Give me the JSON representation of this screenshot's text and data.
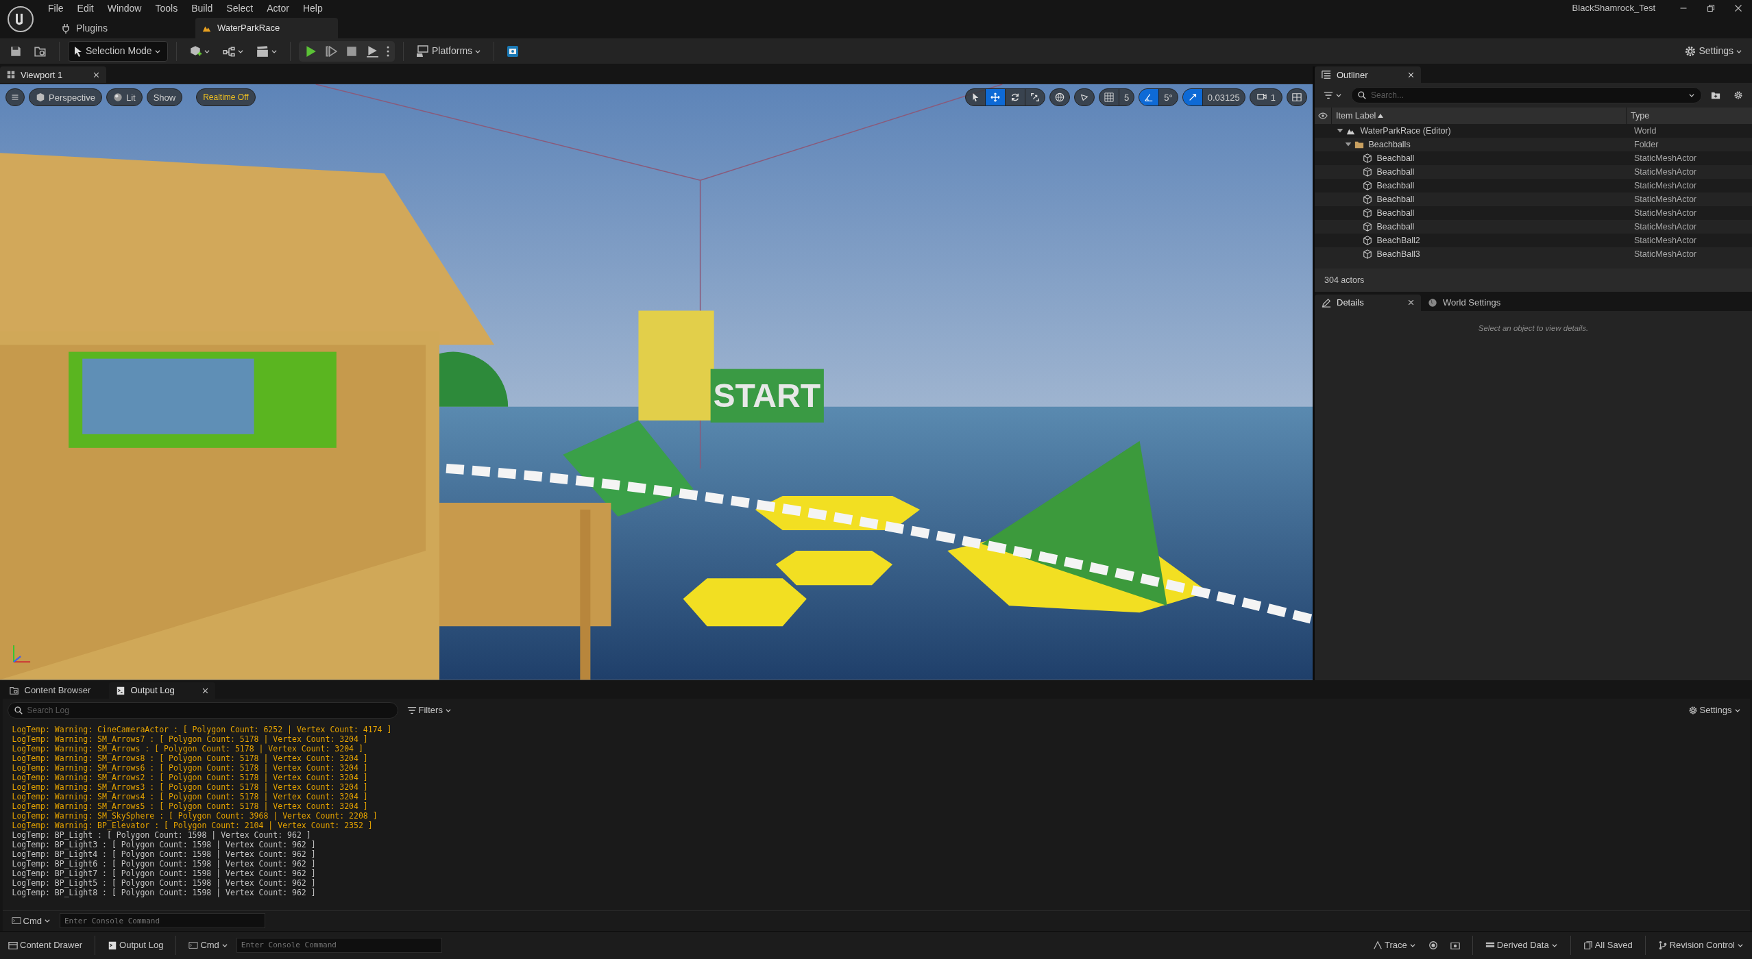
{
  "menu": [
    "File",
    "Edit",
    "Window",
    "Tools",
    "Build",
    "Select",
    "Actor",
    "Help"
  ],
  "project_name": "BlackShamrock_Test",
  "plugins_label": "Plugins",
  "level_tab": {
    "label": "WaterParkRace",
    "selected": true
  },
  "toolbar": {
    "mode_dropdown": "Selection Mode",
    "platforms": "Platforms",
    "settings": "Settings"
  },
  "viewport_tab": {
    "label": "Viewport 1",
    "selected": true
  },
  "viewport": {
    "view_buttons": [
      {
        "kind": "menu"
      },
      {
        "kind": "perspective",
        "label": "Perspective"
      },
      {
        "kind": "lit",
        "label": "Lit"
      },
      {
        "kind": "show",
        "label": "Show"
      }
    ],
    "realtime_label": "Realtime Off",
    "transform_tools": [
      {
        "kind": "select",
        "selected": false
      },
      {
        "kind": "translate",
        "selected": true
      },
      {
        "kind": "rotate",
        "selected": false
      },
      {
        "kind": "scale",
        "selected": false
      }
    ],
    "grid_snap": {
      "value": "5",
      "on": false
    },
    "angle_snap": {
      "value": "5°",
      "on": true
    },
    "scale_snap": {
      "value": "0.03125",
      "on": true
    },
    "camera_speed": "1",
    "scene_sign": "START"
  },
  "outliner": {
    "tab": "Outliner",
    "search_placeholder": "Search...",
    "columns": [
      "Item Label",
      "Type"
    ],
    "tree": [
      {
        "label": "WaterParkRace (Editor)",
        "type": "World",
        "kind": "world",
        "expanded": true,
        "children": [
          {
            "label": "Beachballs",
            "type": "Folder",
            "kind": "folder",
            "expanded": true,
            "children": [
              {
                "label": "Beachball",
                "type": "StaticMeshActor",
                "kind": "mesh"
              },
              {
                "label": "Beachball",
                "type": "StaticMeshActor",
                "kind": "mesh"
              },
              {
                "label": "Beachball",
                "type": "StaticMeshActor",
                "kind": "mesh"
              },
              {
                "label": "Beachball",
                "type": "StaticMeshActor",
                "kind": "mesh"
              },
              {
                "label": "Beachball",
                "type": "StaticMeshActor",
                "kind": "mesh"
              },
              {
                "label": "Beachball",
                "type": "StaticMeshActor",
                "kind": "mesh"
              },
              {
                "label": "BeachBall2",
                "type": "StaticMeshActor",
                "kind": "mesh"
              },
              {
                "label": "BeachBall3",
                "type": "StaticMeshActor",
                "kind": "mesh"
              }
            ]
          }
        ]
      }
    ],
    "actor_count": "304 actors"
  },
  "details": {
    "tabs": [
      {
        "label": "Details",
        "kind": "details",
        "selected": true
      },
      {
        "label": "World Settings",
        "kind": "world",
        "selected": false
      }
    ],
    "empty_message": "Select an object to view details."
  },
  "dock": {
    "tabs": [
      {
        "label": "Content Browser",
        "kind": "browser",
        "selected": false
      },
      {
        "label": "Output Log",
        "kind": "log",
        "selected": true
      }
    ],
    "search_placeholder": "Search Log",
    "filters": "Filters",
    "settings": "Settings",
    "log": [
      {
        "kind": "warning",
        "text": "LogTemp: Warning: CineCameraActor : [ Polygon Count: 6252 | Vertex Count: 4174 ]"
      },
      {
        "kind": "warning",
        "text": "LogTemp: Warning: SM_Arrows7 : [ Polygon Count: 5178 | Vertex Count: 3204 ]"
      },
      {
        "kind": "warning",
        "text": "LogTemp: Warning: SM_Arrows : [ Polygon Count: 5178 | Vertex Count: 3204 ]"
      },
      {
        "kind": "warning",
        "text": "LogTemp: Warning: SM_Arrows8 : [ Polygon Count: 5178 | Vertex Count: 3204 ]"
      },
      {
        "kind": "warning",
        "text": "LogTemp: Warning: SM_Arrows6 : [ Polygon Count: 5178 | Vertex Count: 3204 ]"
      },
      {
        "kind": "warning",
        "text": "LogTemp: Warning: SM_Arrows2 : [ Polygon Count: 5178 | Vertex Count: 3204 ]"
      },
      {
        "kind": "warning",
        "text": "LogTemp: Warning: SM_Arrows3 : [ Polygon Count: 5178 | Vertex Count: 3204 ]"
      },
      {
        "kind": "warning",
        "text": "LogTemp: Warning: SM_Arrows4 : [ Polygon Count: 5178 | Vertex Count: 3204 ]"
      },
      {
        "kind": "warning",
        "text": "LogTemp: Warning: SM_Arrows5 : [ Polygon Count: 5178 | Vertex Count: 3204 ]"
      },
      {
        "kind": "warning",
        "text": "LogTemp: Warning: SM_SkySphere : [ Polygon Count: 3968 | Vertex Count: 2208 ]"
      },
      {
        "kind": "warning",
        "text": "LogTemp: Warning: BP_Elevator : [ Polygon Count: 2104 | Vertex Count: 2352 ]"
      },
      {
        "kind": "info",
        "text": "LogTemp: BP_Light : [ Polygon Count: 1598 | Vertex Count: 962 ]"
      },
      {
        "kind": "info",
        "text": "LogTemp: BP_Light3 : [ Polygon Count: 1598 | Vertex Count: 962 ]"
      },
      {
        "kind": "info",
        "text": "LogTemp: BP_Light4 : [ Polygon Count: 1598 | Vertex Count: 962 ]"
      },
      {
        "kind": "info",
        "text": "LogTemp: BP_Light6 : [ Polygon Count: 1598 | Vertex Count: 962 ]"
      },
      {
        "kind": "info",
        "text": "LogTemp: BP_Light7 : [ Polygon Count: 1598 | Vertex Count: 962 ]"
      },
      {
        "kind": "info",
        "text": "LogTemp: BP_Light5 : [ Polygon Count: 1598 | Vertex Count: 962 ]"
      },
      {
        "kind": "info",
        "text": "LogTemp: BP_Light8 : [ Polygon Count: 1598 | Vertex Count: 962 ]"
      }
    ],
    "cmd": "Cmd",
    "console_placeholder": "Enter Console Command"
  },
  "status_bar": {
    "content_drawer": "Content Drawer",
    "output_log": "Output Log",
    "cmd": "Cmd",
    "console_placeholder": "Enter Console Command",
    "trace": "Trace",
    "derived_data": "Derived Data",
    "save_state": "All Saved",
    "revision_control": "Revision Control"
  }
}
